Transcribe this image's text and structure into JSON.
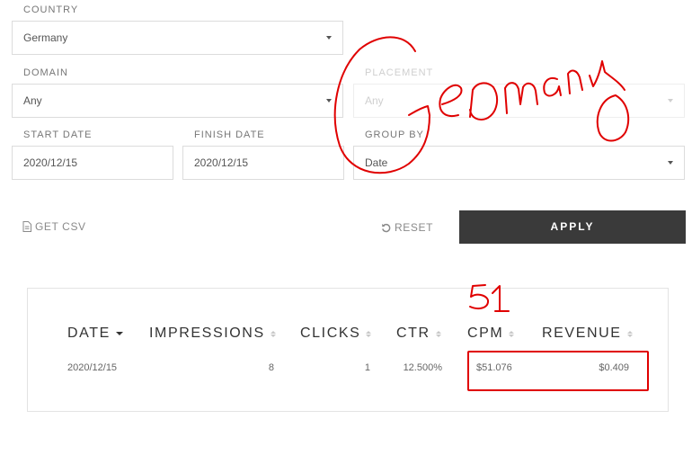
{
  "filters": {
    "country": {
      "label": "COUNTRY",
      "value": "Germany"
    },
    "domain": {
      "label": "DOMAIN",
      "value": "Any"
    },
    "placement": {
      "label": "PLACEMENT",
      "value": "Any"
    },
    "start_date": {
      "label": "START DATE",
      "value": "2020/12/15"
    },
    "finish_date": {
      "label": "FINISH DATE",
      "value": "2020/12/15"
    },
    "group_by": {
      "label": "GROUP BY",
      "value": "Date"
    }
  },
  "actions": {
    "get_csv": "GET CSV",
    "reset": "RESET",
    "apply": "APPLY"
  },
  "table": {
    "headers": [
      "DATE",
      "IMPRESSIONS",
      "CLICKS",
      "CTR",
      "CPM",
      "REVENUE"
    ],
    "rows": [
      [
        "2020/12/15",
        "8",
        "1",
        "12.500%",
        "$51.076",
        "$0.409"
      ]
    ]
  },
  "annotations": {
    "handwritten_country": "Germany",
    "handwritten_cpm": "51",
    "ink_color": "#e00000"
  }
}
